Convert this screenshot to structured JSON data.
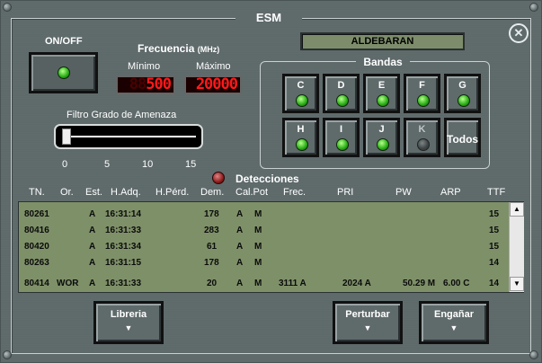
{
  "window": {
    "title": "ESM",
    "close_icon": "close-icon"
  },
  "onoff": {
    "label": "ON/OFF"
  },
  "selected_target": "ALDEBARAN",
  "frecuencia": {
    "title": "Frecuencia",
    "unit": "(MHz)",
    "min_label": "Mínimo",
    "max_label": "Máximo",
    "min_ghost": "88",
    "min_value": "500",
    "max_value": "20000"
  },
  "filtro": {
    "label": "Filtro Grado de Amenaza",
    "ticks": [
      "0",
      "5",
      "10",
      "15"
    ],
    "value": 0
  },
  "bandas": {
    "title": "Bandas",
    "buttons": [
      {
        "label": "C",
        "on": true
      },
      {
        "label": "D",
        "on": true
      },
      {
        "label": "E",
        "on": true
      },
      {
        "label": "F",
        "on": true
      },
      {
        "label": "G",
        "on": true
      },
      {
        "label": "H",
        "on": true
      },
      {
        "label": "I",
        "on": true
      },
      {
        "label": "J",
        "on": true
      },
      {
        "label": "K",
        "on": false
      }
    ],
    "todos_label": "Todos"
  },
  "detecciones": {
    "label": "Detecciones"
  },
  "table": {
    "headers": [
      "TN.",
      "Or.",
      "Est.",
      "H.Adq.",
      "H.Pérd.",
      "Dem.",
      "Cal.Pot",
      "Frec.",
      "PRI",
      "PW",
      "ARP",
      "TTF"
    ],
    "rows": [
      {
        "tn": "80261",
        "or": "",
        "est": "A",
        "hadq": "16:31:14",
        "hperd": "",
        "dem": "178",
        "cal": "A",
        "pot": "M",
        "frec": "",
        "pri": "",
        "pw": "",
        "arp": "",
        "ttf": "15"
      },
      {
        "tn": "80416",
        "or": "",
        "est": "A",
        "hadq": "16:31:33",
        "hperd": "",
        "dem": "283",
        "cal": "A",
        "pot": "M",
        "frec": "",
        "pri": "",
        "pw": "",
        "arp": "",
        "ttf": "15"
      },
      {
        "tn": "80420",
        "or": "",
        "est": "A",
        "hadq": "16:31:34",
        "hperd": "",
        "dem": "61",
        "cal": "A",
        "pot": "M",
        "frec": "",
        "pri": "",
        "pw": "",
        "arp": "",
        "ttf": "15"
      },
      {
        "tn": "80263",
        "or": "",
        "est": "A",
        "hadq": "16:31:15",
        "hperd": "",
        "dem": "178",
        "cal": "A",
        "pot": "M",
        "frec": "",
        "pri": "",
        "pw": "",
        "arp": "",
        "ttf": "14"
      },
      {
        "tn": "80414",
        "or": "WOR",
        "est": "A",
        "hadq": "16:31:33",
        "hperd": "",
        "dem": "20",
        "cal": "A",
        "pot": "M",
        "frec": "3111 A",
        "pri": "2024 A",
        "pw": "50.29 M",
        "arp": "6.00 C",
        "ttf": "14"
      }
    ]
  },
  "buttons": {
    "libreria": "Libreria",
    "perturbar": "Perturbar",
    "enganar": "Engañar"
  }
}
